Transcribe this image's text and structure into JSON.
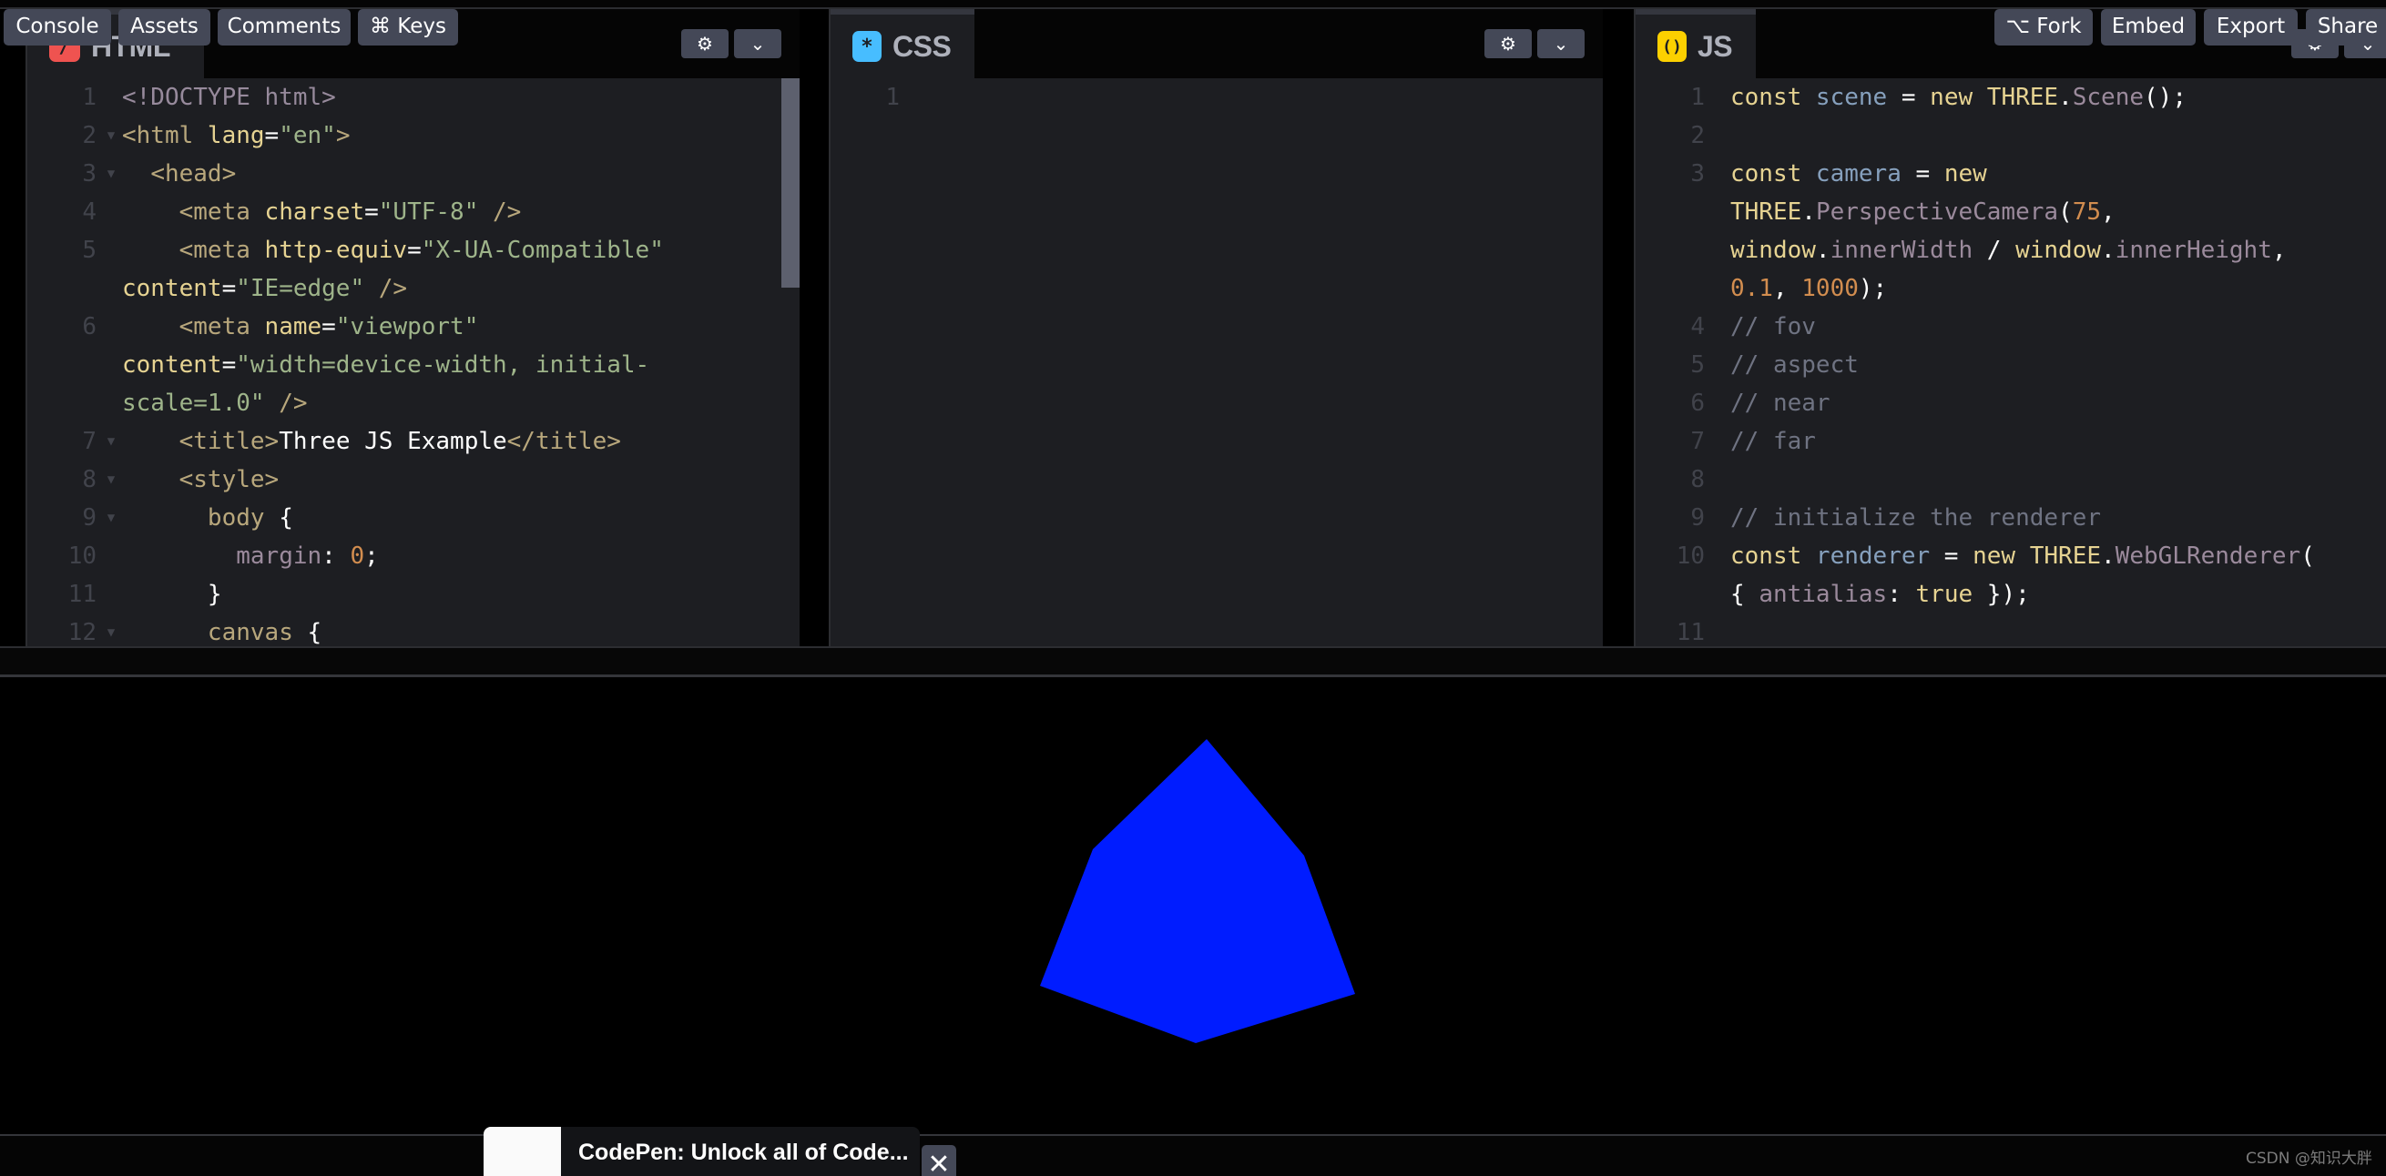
{
  "editors": {
    "html": {
      "label": "HTML",
      "icon": "/",
      "icon_color": "#ef5350",
      "lines": [
        {
          "n": "1",
          "fold": false,
          "segs": [
            [
              "c-doctype",
              "<!DOCTYPE html>"
            ]
          ]
        },
        {
          "n": "2",
          "fold": true,
          "segs": [
            [
              "c-tag",
              "<html "
            ],
            [
              "c-attr",
              "lang"
            ],
            [
              "c-white",
              "="
            ],
            [
              "c-str",
              "\"en\""
            ],
            [
              "c-tag",
              ">"
            ]
          ]
        },
        {
          "n": "3",
          "fold": true,
          "segs": [
            [
              "c-tag",
              "  <head>"
            ]
          ]
        },
        {
          "n": "4",
          "fold": false,
          "segs": [
            [
              "c-tag",
              "    <meta "
            ],
            [
              "c-attr",
              "charset"
            ],
            [
              "c-white",
              "="
            ],
            [
              "c-str",
              "\"UTF-8\""
            ],
            [
              "c-tag",
              " />"
            ]
          ]
        },
        {
          "n": "5",
          "fold": false,
          "segs": [
            [
              "c-tag",
              "    <meta "
            ],
            [
              "c-attr",
              "http-equiv"
            ],
            [
              "c-white",
              "="
            ],
            [
              "c-str",
              "\"X-UA-Compatible\""
            ],
            [
              "c-white",
              "\n"
            ],
            [
              "c-attr",
              "content"
            ],
            [
              "c-white",
              "="
            ],
            [
              "c-str",
              "\"IE=edge\""
            ],
            [
              "c-tag",
              " />"
            ]
          ]
        },
        {
          "n": "6",
          "fold": false,
          "segs": [
            [
              "c-tag",
              "    <meta "
            ],
            [
              "c-attr",
              "name"
            ],
            [
              "c-white",
              "="
            ],
            [
              "c-str",
              "\"viewport\""
            ],
            [
              "c-white",
              "\n"
            ],
            [
              "c-attr",
              "content"
            ],
            [
              "c-white",
              "="
            ],
            [
              "c-str",
              "\"width=device-width, initial-\nscale=1.0\""
            ],
            [
              "c-tag",
              " />"
            ]
          ]
        },
        {
          "n": "7",
          "fold": true,
          "segs": [
            [
              "c-tag",
              "    <title>"
            ],
            [
              "c-white",
              "Three JS Example"
            ],
            [
              "c-tag",
              "</title>"
            ]
          ]
        },
        {
          "n": "8",
          "fold": true,
          "segs": [
            [
              "c-tag",
              "    <style>"
            ]
          ]
        },
        {
          "n": "9",
          "fold": true,
          "segs": [
            [
              "c-tag",
              "      body "
            ],
            [
              "c-white",
              "{"
            ]
          ]
        },
        {
          "n": "10",
          "fold": false,
          "segs": [
            [
              "c-prop",
              "        margin"
            ],
            [
              "c-white",
              ": "
            ],
            [
              "c-num",
              "0"
            ],
            [
              "c-white",
              ";"
            ]
          ]
        },
        {
          "n": "11",
          "fold": false,
          "segs": [
            [
              "c-white",
              "      }"
            ]
          ]
        },
        {
          "n": "12",
          "fold": true,
          "segs": [
            [
              "c-tag",
              "      canvas "
            ],
            [
              "c-white",
              "{"
            ]
          ]
        }
      ]
    },
    "css": {
      "label": "CSS",
      "icon": "*",
      "icon_color": "#47bdff",
      "lines": [
        {
          "n": "1",
          "fold": false,
          "segs": []
        }
      ]
    },
    "js": {
      "label": "JS",
      "icon": "()",
      "icon_color": "#fcd000",
      "lines": [
        {
          "n": "1",
          "fold": false,
          "segs": [
            [
              "c-kw",
              "const "
            ],
            [
              "c-var",
              "scene"
            ],
            [
              "c-white",
              " = "
            ],
            [
              "c-kw",
              "new "
            ],
            [
              "c-attr",
              "THREE"
            ],
            [
              "c-white",
              "."
            ],
            [
              "c-prop",
              "Scene"
            ],
            [
              "c-white",
              "();"
            ]
          ]
        },
        {
          "n": "2",
          "fold": false,
          "segs": []
        },
        {
          "n": "3",
          "fold": false,
          "segs": [
            [
              "c-kw",
              "const "
            ],
            [
              "c-var",
              "camera"
            ],
            [
              "c-white",
              " = "
            ],
            [
              "c-kw",
              "new\n"
            ],
            [
              "c-attr",
              "THREE"
            ],
            [
              "c-white",
              "."
            ],
            [
              "c-prop",
              "PerspectiveCamera"
            ],
            [
              "c-white",
              "("
            ],
            [
              "c-num",
              "75"
            ],
            [
              "c-white",
              ",\n"
            ],
            [
              "c-attr",
              "window"
            ],
            [
              "c-white",
              "."
            ],
            [
              "c-prop",
              "innerWidth"
            ],
            [
              "c-white",
              " / "
            ],
            [
              "c-attr",
              "window"
            ],
            [
              "c-white",
              "."
            ],
            [
              "c-prop",
              "innerHeight"
            ],
            [
              "c-white",
              ",\n"
            ],
            [
              "c-num",
              "0.1"
            ],
            [
              "c-white",
              ", "
            ],
            [
              "c-num",
              "1000"
            ],
            [
              "c-white",
              ");"
            ]
          ]
        },
        {
          "n": "4",
          "fold": false,
          "segs": [
            [
              "c-comment",
              "// fov"
            ]
          ]
        },
        {
          "n": "5",
          "fold": false,
          "segs": [
            [
              "c-comment",
              "// aspect"
            ]
          ]
        },
        {
          "n": "6",
          "fold": false,
          "segs": [
            [
              "c-comment",
              "// near"
            ]
          ]
        },
        {
          "n": "7",
          "fold": false,
          "segs": [
            [
              "c-comment",
              "// far"
            ]
          ]
        },
        {
          "n": "8",
          "fold": false,
          "segs": []
        },
        {
          "n": "9",
          "fold": false,
          "segs": [
            [
              "c-comment",
              "// initialize the renderer"
            ]
          ]
        },
        {
          "n": "10",
          "fold": false,
          "segs": [
            [
              "c-kw",
              "const "
            ],
            [
              "c-var",
              "renderer"
            ],
            [
              "c-white",
              " = "
            ],
            [
              "c-kw",
              "new "
            ],
            [
              "c-attr",
              "THREE"
            ],
            [
              "c-white",
              "."
            ],
            [
              "c-prop",
              "WebGLRenderer"
            ],
            [
              "c-white",
              "(\n{ "
            ],
            [
              "c-prop",
              "antialias"
            ],
            [
              "c-white",
              ": "
            ],
            [
              "c-kw",
              "true"
            ],
            [
              "c-white",
              " });"
            ]
          ]
        },
        {
          "n": "11",
          "fold": false,
          "segs": []
        }
      ]
    }
  },
  "header_buttons": {
    "settings_icon": "gear-icon",
    "collapse_icon": "chevron-down-icon"
  },
  "preview": {
    "background": "#000000",
    "cube_color": "#001cff"
  },
  "bottom_bar": {
    "left": [
      {
        "label": "Console"
      },
      {
        "label": "Assets"
      },
      {
        "label": "Comments"
      },
      {
        "label": "⌘ Keys"
      }
    ],
    "notification": "CodePen: Unlock all of Code...",
    "close": "✕",
    "right": [
      {
        "label": "⌥ Fork"
      },
      {
        "label": "Embed"
      },
      {
        "label": "Export"
      },
      {
        "label": "Share"
      }
    ]
  },
  "watermark": "CSDN @知识大胖"
}
